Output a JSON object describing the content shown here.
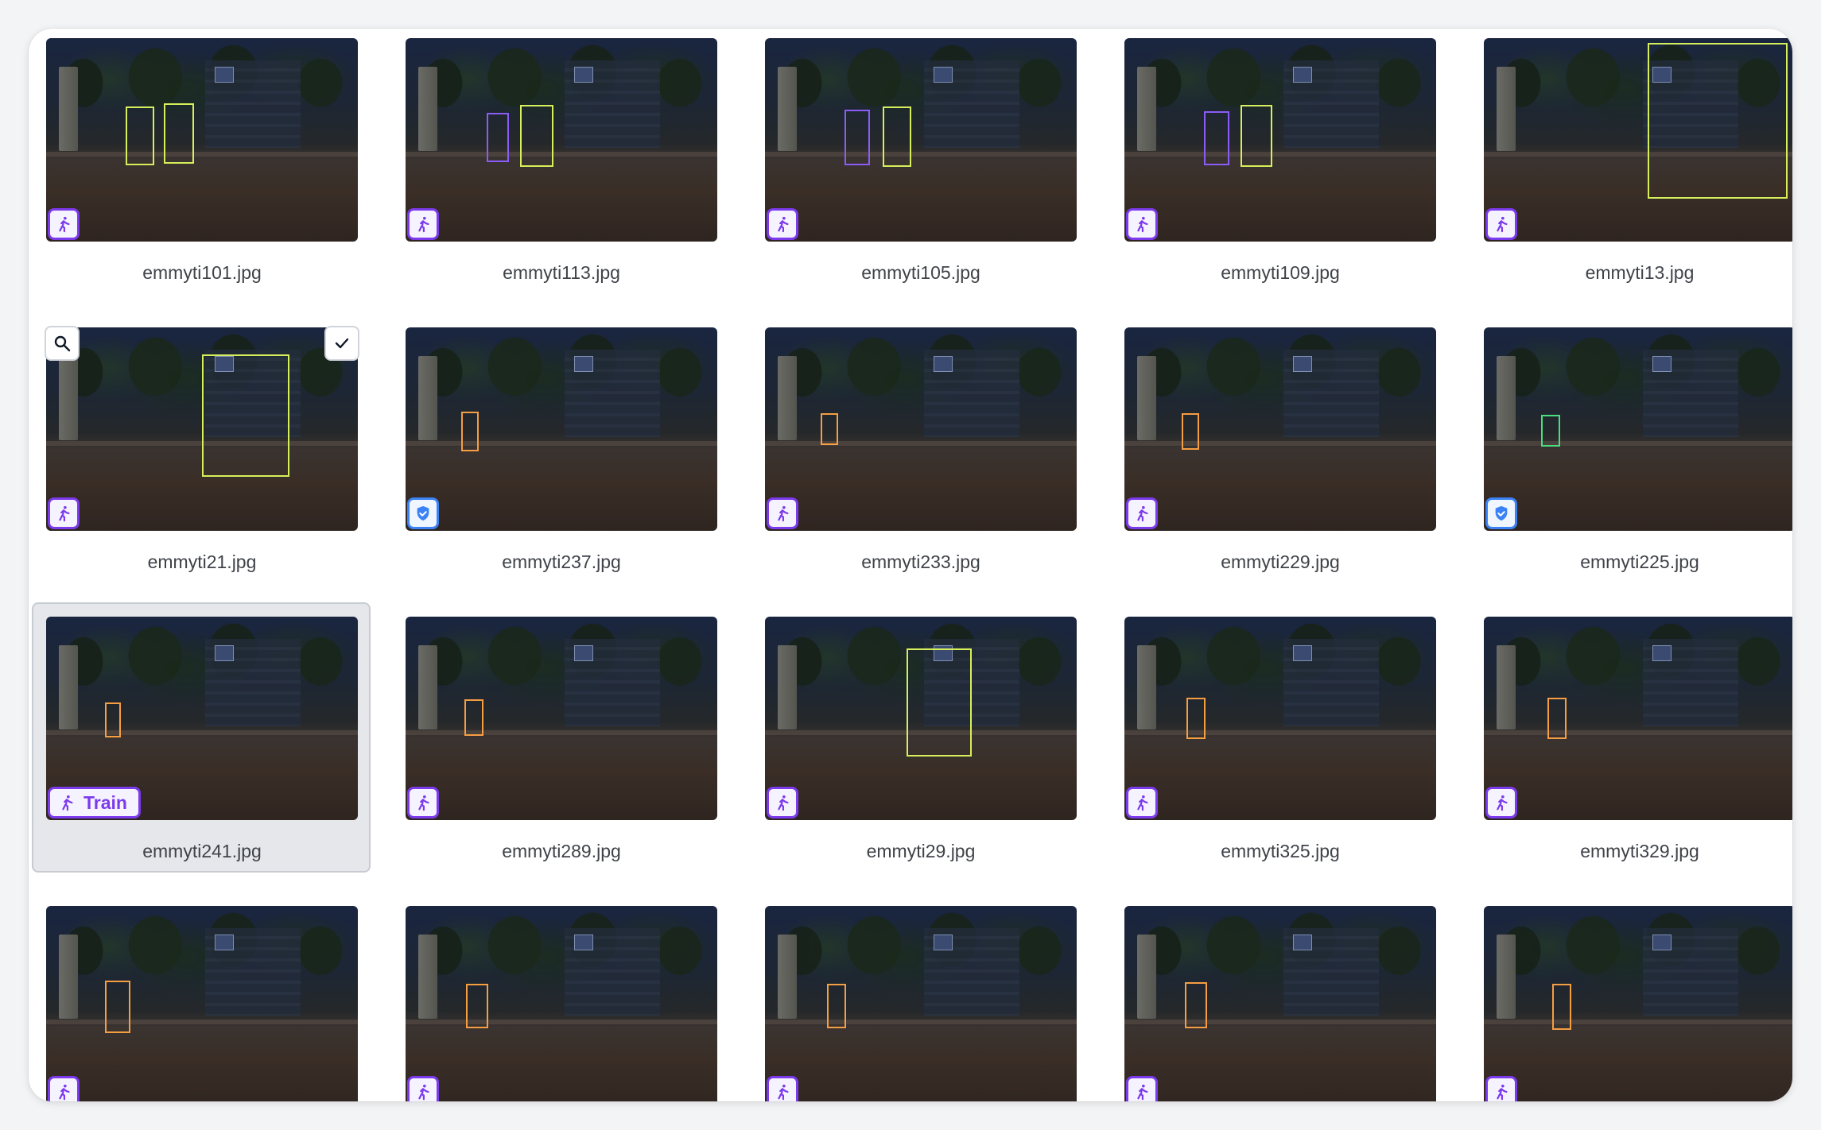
{
  "gallery": {
    "items": [
      {
        "filename": "emmyti101.jpg",
        "badge": "runner-icon"
      },
      {
        "filename": "emmyti113.jpg",
        "badge": "runner-icon"
      },
      {
        "filename": "emmyti105.jpg",
        "badge": "runner-icon"
      },
      {
        "filename": "emmyti109.jpg",
        "badge": "runner-icon"
      },
      {
        "filename": "emmyti13.jpg",
        "badge": "runner-icon"
      },
      {
        "filename": "emmyti21.jpg",
        "badge": "runner-icon",
        "hover_actions": [
          "search-icon",
          "check-icon"
        ]
      },
      {
        "filename": "emmyti237.jpg",
        "badge": "shield-check-icon"
      },
      {
        "filename": "emmyti233.jpg",
        "badge": "runner-icon"
      },
      {
        "filename": "emmyti229.jpg",
        "badge": "runner-icon"
      },
      {
        "filename": "emmyti225.jpg",
        "badge": "shield-check-icon"
      },
      {
        "filename": "emmyti241.jpg",
        "badge": "runner-icon",
        "badge_label": "Train",
        "selected": true
      },
      {
        "filename": "emmyti289.jpg",
        "badge": "runner-icon"
      },
      {
        "filename": "emmyti29.jpg",
        "badge": "runner-icon"
      },
      {
        "filename": "emmyti325.jpg",
        "badge": "runner-icon"
      },
      {
        "filename": "emmyti329.jpg",
        "badge": "runner-icon"
      },
      {
        "filename": "",
        "badge": "runner-icon"
      },
      {
        "filename": "",
        "badge": "runner-icon"
      },
      {
        "filename": "",
        "badge": "runner-icon"
      },
      {
        "filename": "",
        "badge": "runner-icon"
      },
      {
        "filename": "",
        "badge": "runner-icon"
      }
    ]
  },
  "colors": {
    "badge_purple": "#7c3aed",
    "badge_blue": "#3b82f6",
    "bbox_yellow_green": "#d7ef5a",
    "bbox_purple": "#8b5cf6",
    "bbox_orange": "#f59e42",
    "bbox_green": "#4ade80",
    "selected_bg": "#e5e7eb"
  }
}
